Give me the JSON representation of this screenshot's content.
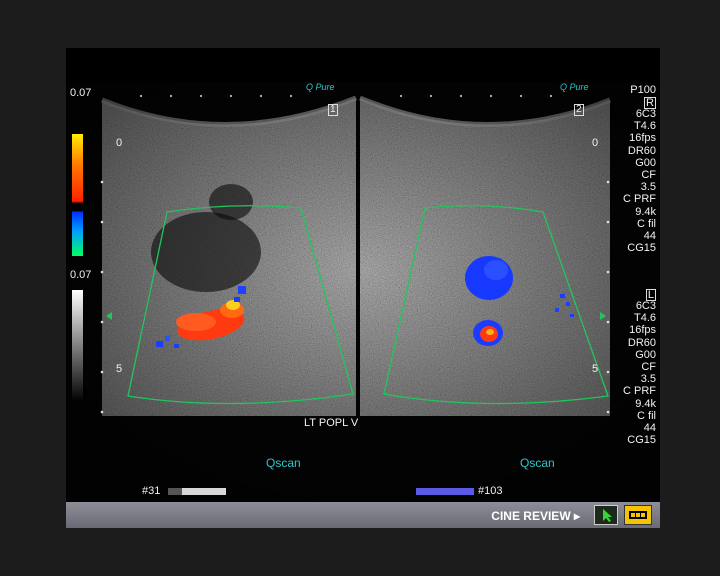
{
  "header": {
    "left_scale_top": "0.07",
    "left_scale_bottom": "0.07",
    "logo_left": "Q Pure",
    "logo_right": "Q Pure"
  },
  "depth_marks": {
    "top": "0",
    "bottom": "5"
  },
  "frames": {
    "left": "1",
    "right": "2"
  },
  "params": {
    "preset": "P100",
    "r_marker": "R",
    "l_marker": "L",
    "block_right": [
      "6C3",
      "T4.6",
      "16fps",
      "DR60",
      "G00",
      "CF",
      "3.5",
      "C PRF",
      "9.4k",
      "C fil",
      "44",
      "CG15"
    ],
    "block_left": [
      "6C3",
      "T4.6",
      "16fps",
      "DR60",
      "G00",
      "CF",
      "3.5",
      "C PRF",
      "9.4k",
      "C fil",
      "44",
      "CG15"
    ]
  },
  "caption": "LT POPL V",
  "qscan_left": "Qscan",
  "qscan_right": "Qscan",
  "cine": {
    "left_frame": "#31",
    "right_frame": "#103"
  },
  "status": {
    "label": "CINE REVIEW"
  },
  "colors": {
    "sector_outline": "#22c55e",
    "flow_red": "#ff3a10",
    "flow_blue": "#1a3cff",
    "accent": "#f4c400"
  }
}
